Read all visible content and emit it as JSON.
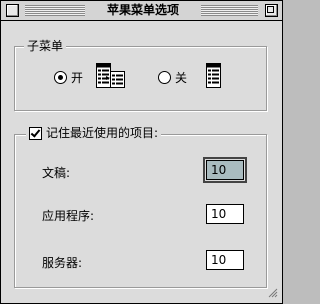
{
  "window": {
    "title": "苹果菜单选项"
  },
  "submenu": {
    "group_label": "子菜单",
    "on_label": "开",
    "off_label": "关",
    "selected": "on"
  },
  "recent": {
    "checkbox_label": "记住最近使用的项目:",
    "checked": true,
    "fields": [
      {
        "label": "文稿:",
        "value": "10"
      },
      {
        "label": "应用程序:",
        "value": "10"
      },
      {
        "label": "服务器:",
        "value": "10"
      }
    ]
  },
  "icons": {
    "close": "close-box-icon",
    "zoom": "zoom-box-icon",
    "submenu_on": "hierarchical-menu-icon",
    "submenu_off": "flat-menu-icon",
    "grow": "resize-grip-icon"
  }
}
